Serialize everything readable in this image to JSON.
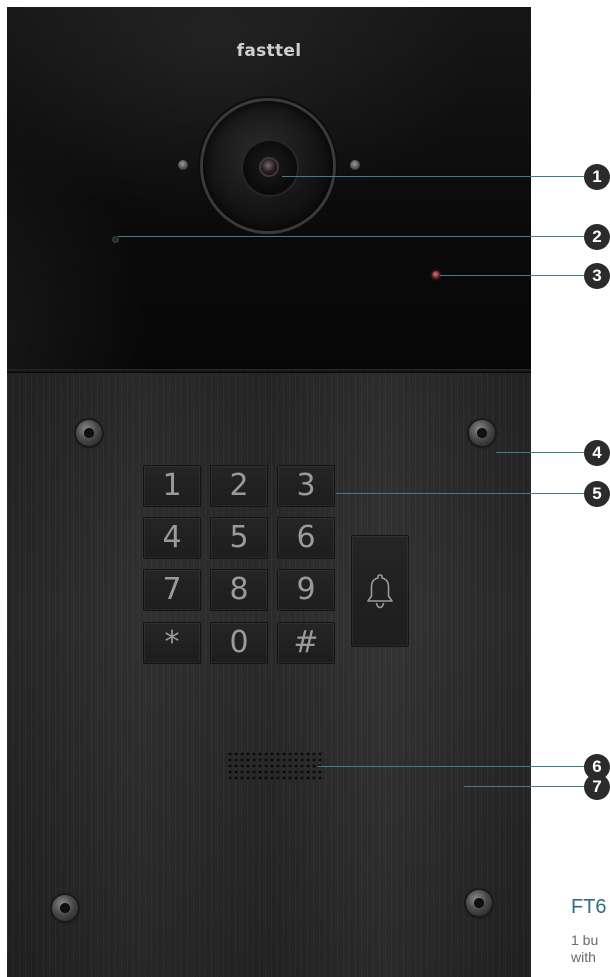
{
  "brand": {
    "logo_text": "fasttel"
  },
  "keypad": {
    "keys": [
      "1",
      "2",
      "3",
      "4",
      "5",
      "6",
      "7",
      "8",
      "9",
      "*",
      "0",
      "#"
    ],
    "bell_icon": "bell-icon"
  },
  "callouts": {
    "badge_color": "#2b2b2b",
    "line_color": "#3f7d8a",
    "items": [
      {
        "number": "1",
        "target": "camera"
      },
      {
        "number": "2",
        "target": "microphone"
      },
      {
        "number": "3",
        "target": "status-led"
      },
      {
        "number": "4",
        "target": "mounting-screw"
      },
      {
        "number": "5",
        "target": "keypad"
      },
      {
        "number": "6",
        "target": "speaker-grille"
      },
      {
        "number": "7",
        "target": "front-plate"
      }
    ]
  },
  "product": {
    "model_text": "FT6",
    "desc_line1": "1 bu",
    "desc_line2": "with",
    "accent_color": "#2f6f80"
  }
}
